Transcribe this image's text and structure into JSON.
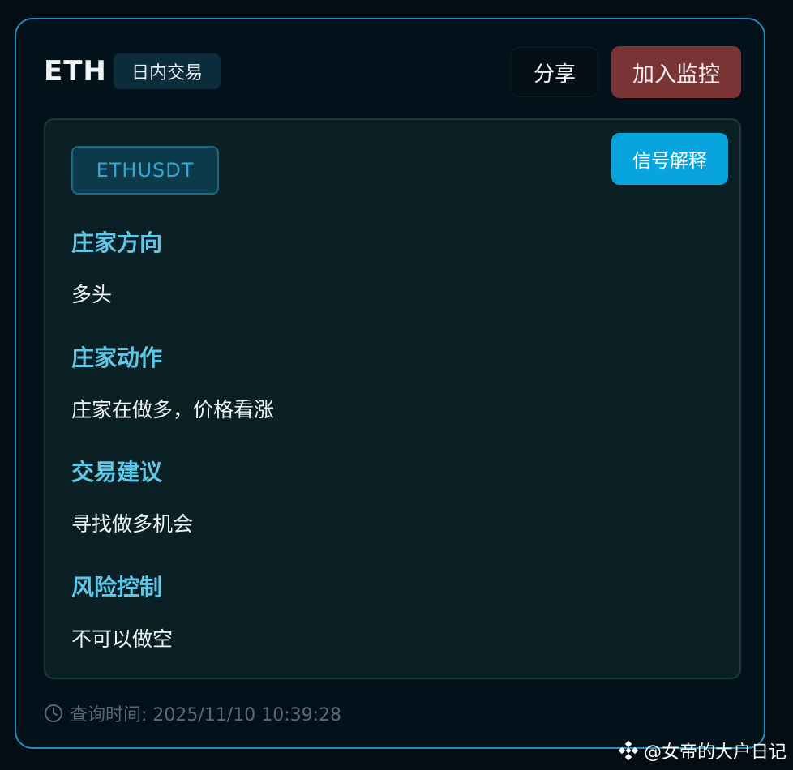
{
  "header": {
    "symbol": "ETH",
    "tag": "日内交易",
    "share_label": "分享",
    "monitor_label": "加入监控"
  },
  "panel": {
    "pair": "ETHUSDT",
    "explain_label": "信号解释",
    "sections": [
      {
        "title": "庄家方向",
        "value": "多头"
      },
      {
        "title": "庄家动作",
        "value": "庄家在做多，价格看涨"
      },
      {
        "title": "交易建议",
        "value": "寻找做多机会"
      },
      {
        "title": "风险控制",
        "value": "不可以做空"
      }
    ]
  },
  "footer": {
    "icon": "clock-icon",
    "query_time": "查询时间: 2025/11/10 10:39:28"
  },
  "watermark": {
    "icon": "binance-logo-icon",
    "text": "@女帝的大户日记"
  },
  "colors": {
    "card_border": "#1f8fbd",
    "accent_title": "#5fc8e8",
    "monitor_button": "#7a3436",
    "explain_button": "#08a4dd",
    "pair_text": "#32a9d4"
  }
}
